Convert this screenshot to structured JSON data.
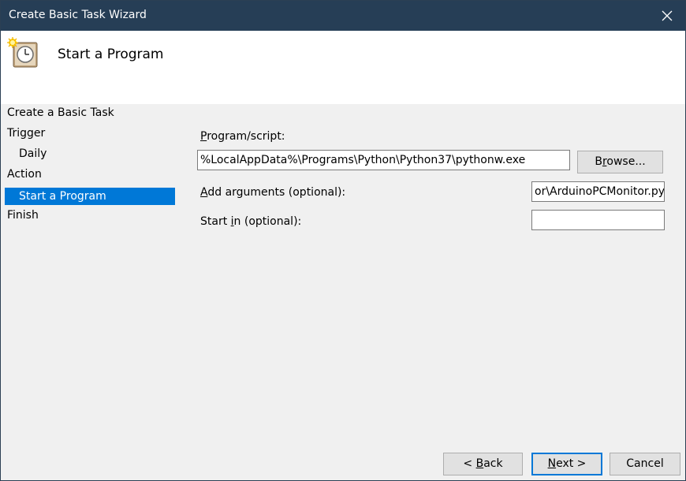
{
  "window": {
    "title": "Create Basic Task Wizard"
  },
  "header": {
    "page_title": "Start a Program",
    "icon": "task-scheduler-clock-icon"
  },
  "nav": {
    "items": [
      {
        "label": "Create a Basic Task"
      },
      {
        "label": "Trigger"
      },
      {
        "label": "Daily"
      },
      {
        "label": "Action"
      },
      {
        "label": "Start a Program",
        "selected": true
      },
      {
        "label": "Finish"
      }
    ]
  },
  "form": {
    "program": {
      "label_u": "P",
      "label_rest": "rogram/script:",
      "value": "%LocalAppData%\\Programs\\Python\\Python37\\pythonw.exe"
    },
    "browse": {
      "pre": "B",
      "u": "r",
      "post": "owse..."
    },
    "arguments": {
      "label_u": "A",
      "label_rest": "dd arguments (optional):",
      "value": "or\\ArduinoPCMonitor.py\""
    },
    "start_in": {
      "label_pre": "Start ",
      "label_u": "i",
      "label_rest": "n (optional):",
      "value": ""
    }
  },
  "footer": {
    "back": {
      "pre": "< ",
      "u": "B",
      "post": "ack"
    },
    "next": {
      "u": "N",
      "post": "ext >"
    },
    "cancel": "Cancel"
  },
  "colors": {
    "titlebar": "#263e56",
    "selection": "#0078d7",
    "default_button_border": "#0078d7"
  }
}
